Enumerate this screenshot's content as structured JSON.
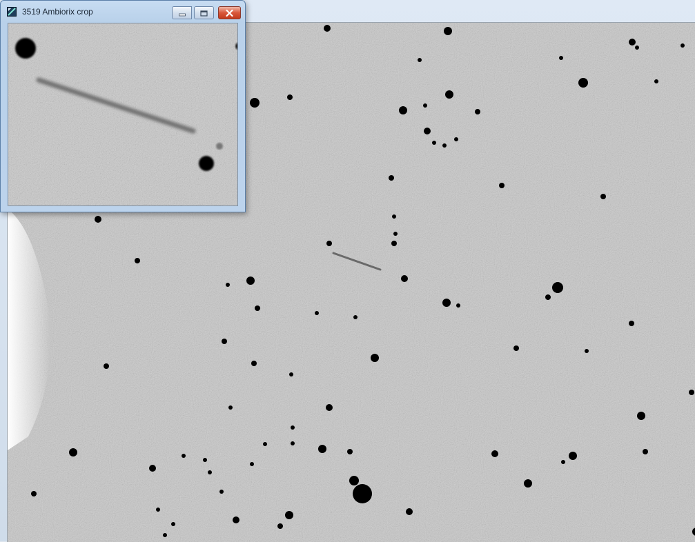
{
  "crop_window": {
    "title": "3519  Ambiorix crop"
  },
  "icons": {
    "app": "app-icon",
    "minimize": "minimize-icon",
    "maximize": "maximize-icon",
    "close": "close-icon"
  },
  "colors": {
    "sky_background": "#c9c9c9",
    "star": "#000000",
    "title_bar": "#bcd3ec",
    "close_button": "#c9432a"
  }
}
